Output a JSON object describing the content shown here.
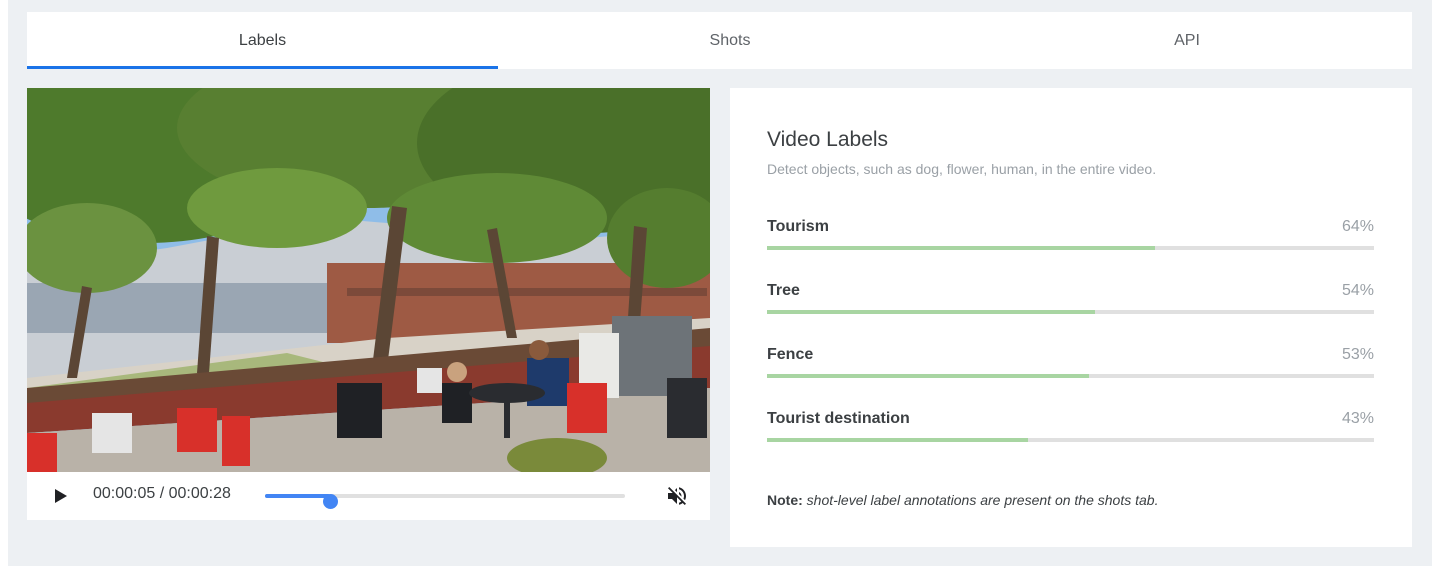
{
  "tabs": [
    {
      "label": "Labels",
      "active": true
    },
    {
      "label": "Shots",
      "active": false
    },
    {
      "label": "API",
      "active": false
    }
  ],
  "player": {
    "time_display": "00:00:05 / 00:00:28",
    "progress": 0.18,
    "muted": true,
    "play_icon": "play-icon",
    "mute_icon": "volume-off-icon"
  },
  "labels_panel": {
    "title": "Video Labels",
    "subtitle": "Detect objects, such as dog, flower, human, in the entire video.",
    "items": [
      {
        "name": "Tourism",
        "percent": "64%",
        "value": 0.64
      },
      {
        "name": "Tree",
        "percent": "54%",
        "value": 0.54
      },
      {
        "name": "Fence",
        "percent": "53%",
        "value": 0.53
      },
      {
        "name": "Tourist destination",
        "percent": "43%",
        "value": 0.43
      }
    ],
    "note_prefix": "Note:",
    "note_text": "shot-level label annotations are present on the shots tab."
  },
  "colors": {
    "accent": "#1a73e8",
    "seek": "#4285f4",
    "bar_fill": "#a8d5a2",
    "bar_track": "#e0e0e0",
    "page_bg": "#edf0f3"
  }
}
